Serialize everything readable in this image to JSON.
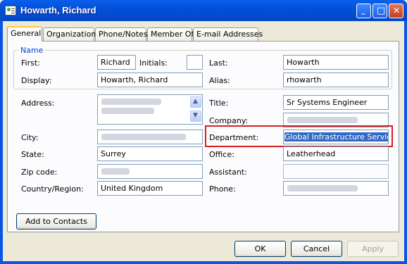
{
  "window": {
    "title": "Howarth, Richard"
  },
  "title_buttons": {
    "minimize": "_",
    "maximize": "□",
    "close": "✕"
  },
  "tabs": [
    "General",
    "Organization",
    "Phone/Notes",
    "Member Of",
    "E-mail Addresses"
  ],
  "name_group": {
    "label": "Name",
    "first_label": "First:",
    "first_value": "Richard",
    "initials_label": "Initials:",
    "initials_value": "",
    "last_label": "Last:",
    "last_value": "Howarth",
    "display_label": "Display:",
    "display_value": "Howarth, Richard",
    "alias_label": "Alias:",
    "alias_value": "rhowarth"
  },
  "details": {
    "address_label": "Address:",
    "city_label": "City:",
    "state_label": "State:",
    "state_value": "Surrey",
    "zip_label": "Zip code:",
    "country_label": "Country/Region:",
    "country_value": "United Kingdom",
    "title_label": "Title:",
    "title_value": "Sr Systems Engineer",
    "company_label": "Company:",
    "department_label": "Department:",
    "department_value": "Global Infrastructure Service",
    "office_label": "Office:",
    "office_value": "Leatherhead",
    "assistant_label": "Assistant:",
    "assistant_value": "",
    "phone_label": "Phone:"
  },
  "buttons": {
    "add_to_contacts": "Add to Contacts",
    "ok": "OK",
    "cancel": "Cancel",
    "apply": "Apply"
  },
  "colors": {
    "highlight": "#d82020",
    "selection": "#316ac5",
    "title_bar": "#0450d8"
  }
}
